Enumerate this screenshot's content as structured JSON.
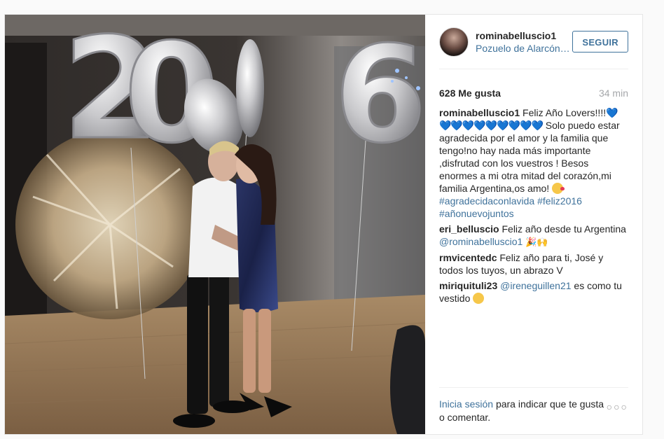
{
  "post": {
    "username": "rominabelluscio1",
    "location": "Pozuelo de Alarcón…",
    "follow_label": "SEGUIR",
    "likes": "628 Me gusta",
    "time_ago": "34 min"
  },
  "caption": {
    "user": "rominabelluscio1",
    "line1": "Feliz Año Lovers!!!!",
    "hearts": "💙💙💙💙💙💙💙💙💙💙",
    "body": "Solo puedo estar agradecida por el amor y la familia que tengo!no hay nada más importante ,disfrutad con los vuestros ! Besos enormes a mi otra mitad del corazón,mi familia Argentina,os amo! ",
    "tags": [
      "#agradecidaconlavida",
      "#feliz2016",
      "#añonuevojuntos"
    ]
  },
  "comments": [
    {
      "user": "eri_belluscio",
      "text": "Feliz año desde tu Argentina",
      "mention": "@rominabelluscio1",
      "emoji": "🎉🙌"
    },
    {
      "user": "rmvicentedc",
      "text": "Feliz año para ti, José y todos los tuyos, un abrazo V"
    },
    {
      "user": "miriquituli23",
      "mention": "@ireneguillen21",
      "text": "es como tu vestido"
    }
  ],
  "footer": {
    "login_link": "Inicia sesión",
    "rest": "para indicar que te gusta o comentar.",
    "more": "○○○"
  },
  "photo": {
    "balloons": [
      "2",
      "0",
      "6"
    ]
  },
  "colors": {
    "link": "#3f729b",
    "text": "#262626",
    "muted": "#a5a7aa",
    "border": "#e6e6e6"
  }
}
